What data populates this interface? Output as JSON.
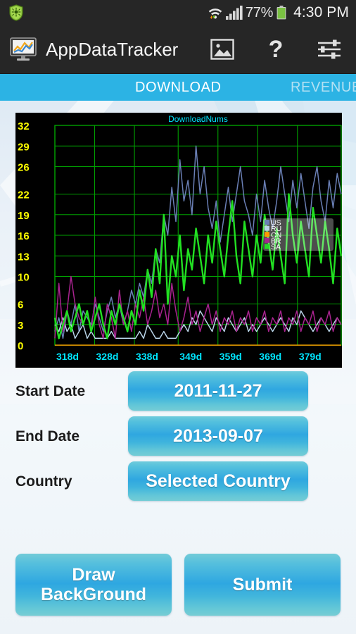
{
  "status_bar": {
    "notification_icon": "shield-icon",
    "wifi_icon": "wifi-icon",
    "signal_icon": "signal-bars-icon",
    "battery_percent": "77%",
    "battery_icon": "battery-icon",
    "clock": "4:30 PM"
  },
  "action_bar": {
    "app_icon": "monitor-chart-icon",
    "title": "AppDataTracker",
    "actions": [
      {
        "name": "image-icon",
        "label": ""
      },
      {
        "name": "help-icon",
        "label": "?"
      },
      {
        "name": "settings-sliders-icon",
        "label": ""
      }
    ]
  },
  "tabs": [
    {
      "label": "DOWNLOAD",
      "active": true
    },
    {
      "label": "REVENUE",
      "active": false
    }
  ],
  "form": {
    "rows": [
      {
        "label": "Start Date",
        "value": "2011-11-27"
      },
      {
        "label": "End Date",
        "value": "2013-09-07"
      },
      {
        "label": "Country",
        "value": "Selected Country"
      }
    ]
  },
  "bottom_buttons": [
    {
      "label": "Draw\nBackGround"
    },
    {
      "label": "Submit"
    }
  ],
  "colors": {
    "tab_bar": "#2cb3e4",
    "action_bar": "#262626",
    "status_bar": "#262626",
    "chart_bg": "#000000",
    "grid": "#00a000",
    "y_tick": "#ffff00",
    "x_tick": "#00e5ff",
    "title": "#00e5ff",
    "button_accent": "#2ea7e1"
  },
  "chart_data": {
    "type": "line",
    "title": "DownloadNums",
    "xlabel": "",
    "ylabel": "",
    "grid": true,
    "legend_position": "middle-right",
    "xlim": [
      0,
      72
    ],
    "ylim": [
      0,
      32
    ],
    "ytick_labels": [
      "0",
      "3",
      "6",
      "10",
      "13",
      "16",
      "19",
      "22",
      "26",
      "29",
      "32"
    ],
    "ytick_values": [
      0,
      3,
      6,
      10,
      13,
      16,
      19,
      22,
      26,
      29,
      32
    ],
    "xtick_labels": [
      "318d",
      "328d",
      "338d",
      "349d",
      "359d",
      "369d",
      "379d"
    ],
    "xtick_values": [
      0,
      10,
      20,
      31,
      41,
      51,
      61
    ],
    "legend": [
      "US",
      "RU",
      "CN",
      "BR",
      "SA"
    ],
    "series": [
      {
        "name": "US",
        "color": "#6a7fb5",
        "values": [
          2,
          4,
          1,
          5,
          3,
          6,
          2,
          5,
          4,
          3,
          6,
          4,
          2,
          5,
          7,
          4,
          6,
          3,
          5,
          8,
          6,
          9,
          7,
          11,
          9,
          14,
          12,
          19,
          16,
          23,
          18,
          27,
          21,
          24,
          19,
          29,
          22,
          26,
          20,
          17,
          21,
          15,
          19,
          23,
          18,
          22,
          26,
          21,
          19,
          16,
          22,
          18,
          24,
          20,
          17,
          21,
          26,
          22,
          18,
          24,
          20,
          25,
          21,
          17,
          23,
          26,
          21,
          18,
          24,
          20,
          25,
          22
        ]
      },
      {
        "name": "RU",
        "color": "#b9d4e8",
        "values": [
          3,
          2,
          4,
          2,
          3,
          1,
          2,
          3,
          1,
          2,
          1,
          1,
          1,
          1,
          2,
          1,
          1,
          1,
          1,
          1,
          1,
          2,
          1,
          3,
          2,
          1,
          1,
          2,
          1,
          1,
          1,
          2,
          3,
          2,
          4,
          3,
          5,
          4,
          3,
          2,
          4,
          3,
          2,
          4,
          3,
          2,
          3,
          4,
          2,
          3,
          2,
          3,
          4,
          3,
          2,
          3,
          4,
          3,
          2,
          4,
          3,
          5,
          4,
          3,
          2,
          3,
          4,
          3,
          2,
          3,
          4,
          3
        ]
      },
      {
        "name": "CN",
        "color": "#ff9800",
        "values": [
          0,
          0,
          0,
          0,
          0,
          0,
          0,
          0,
          0,
          0,
          0,
          0,
          0,
          0,
          0,
          0,
          0,
          0,
          0,
          0,
          0,
          0,
          0,
          0,
          0,
          0,
          0,
          0,
          0,
          0,
          0,
          0,
          0,
          0,
          0,
          0,
          0,
          0,
          0,
          0,
          0,
          0,
          0,
          0,
          0,
          0,
          0,
          0,
          0,
          0,
          0,
          0,
          0,
          0,
          0,
          0,
          0,
          0,
          0,
          0,
          0,
          0,
          0,
          0,
          0,
          0,
          0,
          0,
          0,
          0,
          0,
          0
        ]
      },
      {
        "name": "BR",
        "color": "#a8238f",
        "values": [
          1,
          9,
          2,
          5,
          10,
          6,
          4,
          3,
          5,
          2,
          7,
          3,
          1,
          6,
          4,
          1,
          8,
          3,
          5,
          2,
          6,
          4,
          7,
          3,
          5,
          8,
          4,
          6,
          3,
          9,
          5,
          2,
          4,
          7,
          3,
          5,
          2,
          4,
          6,
          3,
          5,
          2,
          4,
          3,
          5,
          2,
          4,
          3,
          5,
          2,
          4,
          3,
          5,
          2,
          4,
          3,
          5,
          2,
          4,
          3,
          5,
          2,
          4,
          3,
          5,
          2,
          4,
          3,
          5,
          2,
          4,
          3
        ]
      },
      {
        "name": "SA",
        "color": "#22e022",
        "values": [
          4,
          1,
          3,
          5,
          2,
          4,
          6,
          3,
          5,
          2,
          4,
          6,
          3,
          1,
          5,
          3,
          6,
          4,
          2,
          5,
          3,
          8,
          5,
          11,
          7,
          14,
          9,
          19,
          6,
          13,
          10,
          16,
          8,
          14,
          11,
          17,
          13,
          9,
          16,
          12,
          18,
          14,
          10,
          16,
          21,
          13,
          9,
          18,
          14,
          10,
          16,
          12,
          19,
          15,
          11,
          17,
          13,
          9,
          22,
          16,
          12,
          18,
          14,
          10,
          20,
          16,
          12,
          18,
          14,
          9,
          17,
          13
        ]
      }
    ]
  }
}
